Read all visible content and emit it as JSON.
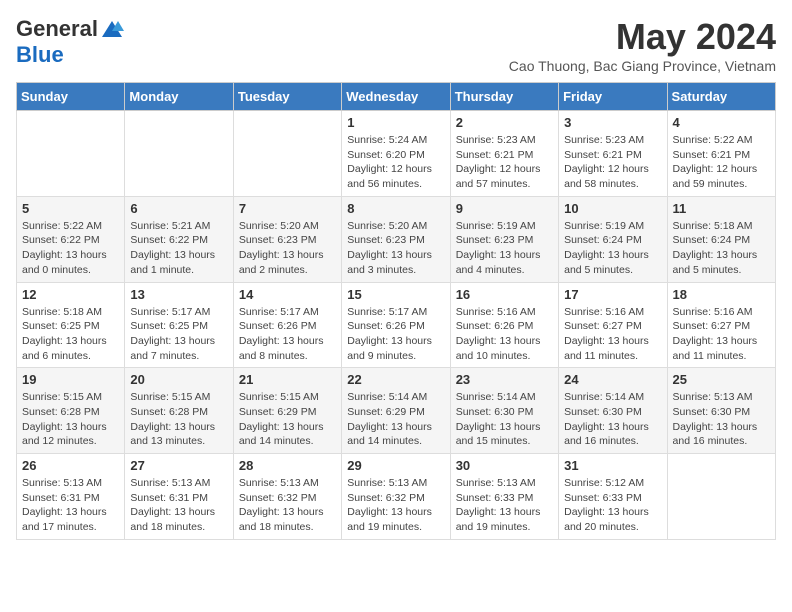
{
  "logo": {
    "general": "General",
    "blue": "Blue"
  },
  "title": {
    "month_year": "May 2024",
    "location": "Cao Thuong, Bac Giang Province, Vietnam"
  },
  "headers": [
    "Sunday",
    "Monday",
    "Tuesday",
    "Wednesday",
    "Thursday",
    "Friday",
    "Saturday"
  ],
  "weeks": [
    [
      {
        "day": "",
        "info": ""
      },
      {
        "day": "",
        "info": ""
      },
      {
        "day": "",
        "info": ""
      },
      {
        "day": "1",
        "info": "Sunrise: 5:24 AM\nSunset: 6:20 PM\nDaylight: 12 hours and 56 minutes."
      },
      {
        "day": "2",
        "info": "Sunrise: 5:23 AM\nSunset: 6:21 PM\nDaylight: 12 hours and 57 minutes."
      },
      {
        "day": "3",
        "info": "Sunrise: 5:23 AM\nSunset: 6:21 PM\nDaylight: 12 hours and 58 minutes."
      },
      {
        "day": "4",
        "info": "Sunrise: 5:22 AM\nSunset: 6:21 PM\nDaylight: 12 hours and 59 minutes."
      }
    ],
    [
      {
        "day": "5",
        "info": "Sunrise: 5:22 AM\nSunset: 6:22 PM\nDaylight: 13 hours and 0 minutes."
      },
      {
        "day": "6",
        "info": "Sunrise: 5:21 AM\nSunset: 6:22 PM\nDaylight: 13 hours and 1 minute."
      },
      {
        "day": "7",
        "info": "Sunrise: 5:20 AM\nSunset: 6:23 PM\nDaylight: 13 hours and 2 minutes."
      },
      {
        "day": "8",
        "info": "Sunrise: 5:20 AM\nSunset: 6:23 PM\nDaylight: 13 hours and 3 minutes."
      },
      {
        "day": "9",
        "info": "Sunrise: 5:19 AM\nSunset: 6:23 PM\nDaylight: 13 hours and 4 minutes."
      },
      {
        "day": "10",
        "info": "Sunrise: 5:19 AM\nSunset: 6:24 PM\nDaylight: 13 hours and 5 minutes."
      },
      {
        "day": "11",
        "info": "Sunrise: 5:18 AM\nSunset: 6:24 PM\nDaylight: 13 hours and 5 minutes."
      }
    ],
    [
      {
        "day": "12",
        "info": "Sunrise: 5:18 AM\nSunset: 6:25 PM\nDaylight: 13 hours and 6 minutes."
      },
      {
        "day": "13",
        "info": "Sunrise: 5:17 AM\nSunset: 6:25 PM\nDaylight: 13 hours and 7 minutes."
      },
      {
        "day": "14",
        "info": "Sunrise: 5:17 AM\nSunset: 6:26 PM\nDaylight: 13 hours and 8 minutes."
      },
      {
        "day": "15",
        "info": "Sunrise: 5:17 AM\nSunset: 6:26 PM\nDaylight: 13 hours and 9 minutes."
      },
      {
        "day": "16",
        "info": "Sunrise: 5:16 AM\nSunset: 6:26 PM\nDaylight: 13 hours and 10 minutes."
      },
      {
        "day": "17",
        "info": "Sunrise: 5:16 AM\nSunset: 6:27 PM\nDaylight: 13 hours and 11 minutes."
      },
      {
        "day": "18",
        "info": "Sunrise: 5:16 AM\nSunset: 6:27 PM\nDaylight: 13 hours and 11 minutes."
      }
    ],
    [
      {
        "day": "19",
        "info": "Sunrise: 5:15 AM\nSunset: 6:28 PM\nDaylight: 13 hours and 12 minutes."
      },
      {
        "day": "20",
        "info": "Sunrise: 5:15 AM\nSunset: 6:28 PM\nDaylight: 13 hours and 13 minutes."
      },
      {
        "day": "21",
        "info": "Sunrise: 5:15 AM\nSunset: 6:29 PM\nDaylight: 13 hours and 14 minutes."
      },
      {
        "day": "22",
        "info": "Sunrise: 5:14 AM\nSunset: 6:29 PM\nDaylight: 13 hours and 14 minutes."
      },
      {
        "day": "23",
        "info": "Sunrise: 5:14 AM\nSunset: 6:30 PM\nDaylight: 13 hours and 15 minutes."
      },
      {
        "day": "24",
        "info": "Sunrise: 5:14 AM\nSunset: 6:30 PM\nDaylight: 13 hours and 16 minutes."
      },
      {
        "day": "25",
        "info": "Sunrise: 5:13 AM\nSunset: 6:30 PM\nDaylight: 13 hours and 16 minutes."
      }
    ],
    [
      {
        "day": "26",
        "info": "Sunrise: 5:13 AM\nSunset: 6:31 PM\nDaylight: 13 hours and 17 minutes."
      },
      {
        "day": "27",
        "info": "Sunrise: 5:13 AM\nSunset: 6:31 PM\nDaylight: 13 hours and 18 minutes."
      },
      {
        "day": "28",
        "info": "Sunrise: 5:13 AM\nSunset: 6:32 PM\nDaylight: 13 hours and 18 minutes."
      },
      {
        "day": "29",
        "info": "Sunrise: 5:13 AM\nSunset: 6:32 PM\nDaylight: 13 hours and 19 minutes."
      },
      {
        "day": "30",
        "info": "Sunrise: 5:13 AM\nSunset: 6:33 PM\nDaylight: 13 hours and 19 minutes."
      },
      {
        "day": "31",
        "info": "Sunrise: 5:12 AM\nSunset: 6:33 PM\nDaylight: 13 hours and 20 minutes."
      },
      {
        "day": "",
        "info": ""
      }
    ]
  ]
}
